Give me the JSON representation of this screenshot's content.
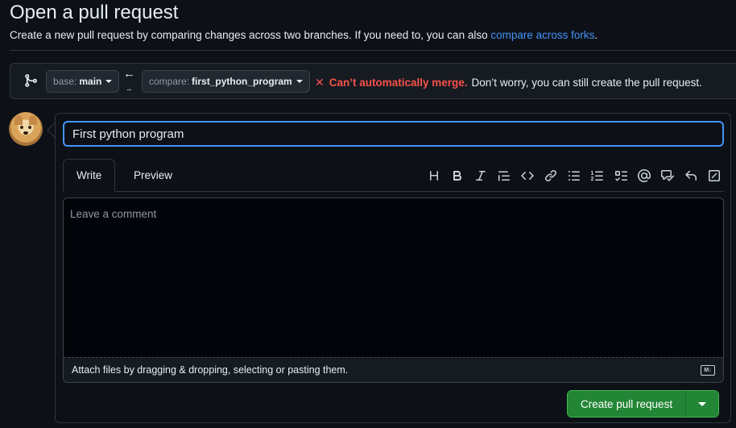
{
  "header": {
    "title": "Open a pull request",
    "subtitle_text": "Create a new pull request by comparing changes across two branches. If you need to, you can also",
    "subtitle_link": "compare across forks",
    "subtitle_end": "."
  },
  "range": {
    "base_label": "base:",
    "base_value": "main",
    "compare_label": "compare:",
    "compare_value": "first_python_program",
    "merge_icon": "x-icon",
    "merge_status": "Can’t automatically merge.",
    "merge_note": "Don’t worry, you can still create the pull request."
  },
  "form": {
    "title_value": "First python program",
    "tabs": [
      "Write",
      "Preview"
    ],
    "comment_placeholder": "Leave a comment",
    "attach_text": "Attach files by dragging & dropping, selecting or pasting them.",
    "markdown_badge": "M↓",
    "toolbar": [
      "heading-icon",
      "bold-icon",
      "italic-icon",
      "quote-icon",
      "code-icon",
      "link-icon",
      "unordered-list-icon",
      "ordered-list-icon",
      "task-list-icon",
      "mention-icon",
      "cross-reference-icon",
      "reply-icon",
      "fullscreen-icon"
    ],
    "submit_label": "Create pull request"
  },
  "colors": {
    "accent": "#4493f8",
    "danger": "#f85149",
    "success": "#238636",
    "background": "#0d1117"
  }
}
